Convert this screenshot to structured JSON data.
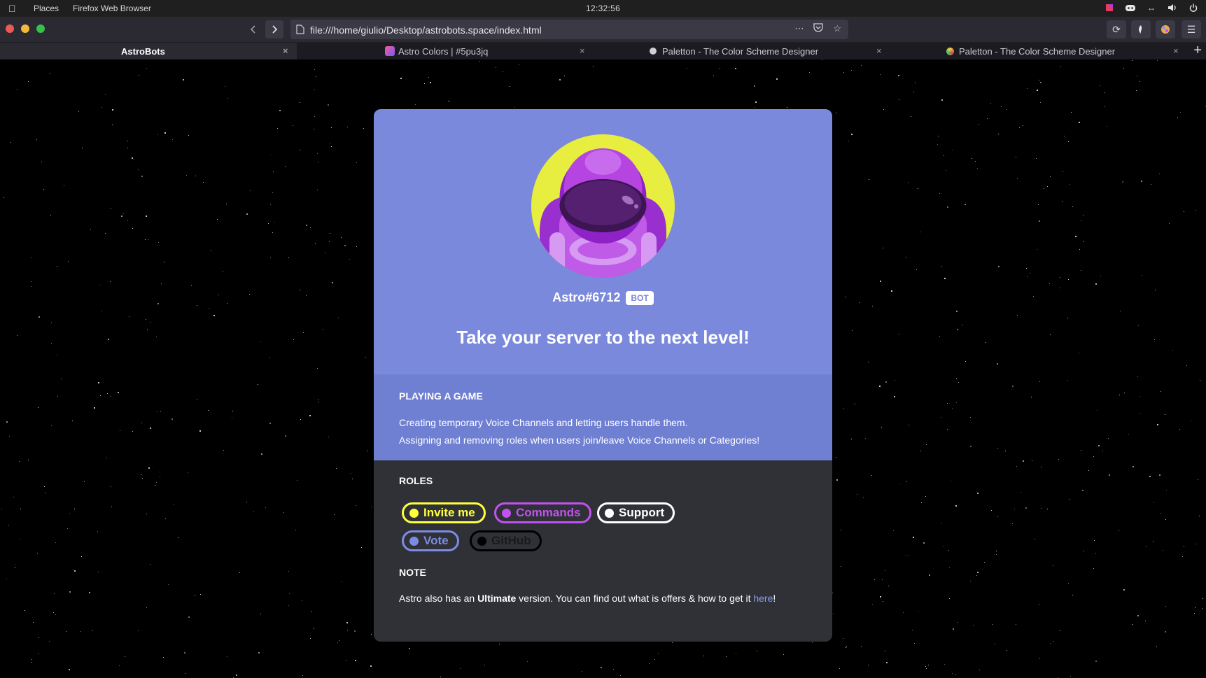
{
  "os": {
    "menu_places": "Places",
    "menu_app": "Firefox Web Browser",
    "clock": "12:32:56",
    "tray_icons": [
      "astro-app-icon",
      "discord-icon",
      "network-icon",
      "volume-icon",
      "power-icon"
    ]
  },
  "browser": {
    "url": "file:///home/giulio/Desktop/astrobots.space/index.html",
    "tabs": [
      {
        "label": "AstroBots",
        "favicon": "",
        "active": true
      },
      {
        "label": "Astro Colors | #5pu3jq",
        "favicon": "colors-favicon",
        "active": false
      },
      {
        "label": "Paletton - The Color Scheme Designer",
        "favicon": "paletton-favicon",
        "active": false
      },
      {
        "label": "Paletton - The Color Scheme Designer",
        "favicon": "paletton-favicon",
        "active": false
      }
    ],
    "tab_close": "×",
    "new_tab": "+"
  },
  "profile": {
    "name": "Astro#6712",
    "badge": "BOT",
    "tagline": "Take your server to the next level!"
  },
  "game": {
    "title": "PLAYING A GAME",
    "lines": [
      "Creating temporary Voice Channels and letting users handle them.",
      "Assigning and removing roles when users join/leave Voice Channels or Categories!"
    ]
  },
  "roles": {
    "title": "ROLES",
    "items": [
      {
        "label": "Invite me",
        "color": "#ffff3c"
      },
      {
        "label": "Commands",
        "color": "#c251f2"
      },
      {
        "label": "Support",
        "color": "#ffffff"
      },
      {
        "label": "Vote",
        "color": "#7c8ce4"
      },
      {
        "label": "GitHub",
        "color": "#000000"
      }
    ]
  },
  "note": {
    "title": "NOTE",
    "before": "Astro also has an ",
    "bold": "Ultimate",
    "after": " version. You can find out what is offers & how to get it ",
    "link": "here",
    "end": "!"
  },
  "colors": {
    "card_top": "#7a89dc",
    "card_game": "#6f7fd2",
    "card_bottom": "#2f3136",
    "sun": "#e7ee3f",
    "astronaut": "#b544e0"
  }
}
